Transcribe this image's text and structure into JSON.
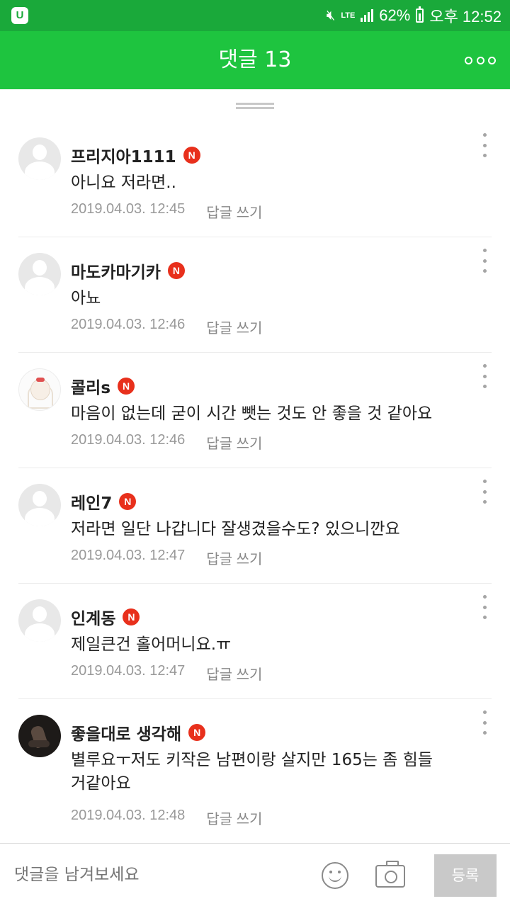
{
  "status_bar": {
    "app_badge": "U",
    "network": "LTE",
    "battery": "62%",
    "time": "오후 12:52",
    "icons": [
      "app-badge-icon",
      "mute-icon",
      "signal-icon",
      "battery-icon"
    ]
  },
  "header": {
    "title": "댓글 13",
    "more_icon": "more-horizontal-icon"
  },
  "comments": [
    {
      "author": "프리지아1111",
      "badge": "N",
      "text": "아니요 저라면..",
      "date": "2019.04.03. 12:45",
      "reply": "답글 쓰기",
      "avatar": "default-avatar-icon"
    },
    {
      "author": "마도카마기카",
      "badge": "N",
      "text": "아뇨",
      "date": "2019.04.03. 12:46",
      "reply": "답글 쓰기",
      "avatar": "default-avatar-icon"
    },
    {
      "author": "콜리s",
      "badge": "N",
      "text": "마음이 없는데 굳이 시간 뺏는 것도 안 좋을 것 같아요",
      "date": "2019.04.03. 12:46",
      "reply": "답글 쓰기",
      "avatar": "profile-illustration"
    },
    {
      "author": "레인7",
      "badge": "N",
      "text": "저라면 일단 나갑니다 잘생겼을수도? 있으니깐요",
      "date": "2019.04.03. 12:47",
      "reply": "답글 쓰기",
      "avatar": "default-avatar-icon"
    },
    {
      "author": "인계동",
      "badge": "N",
      "text": "제일큰건 홀어머니요.ㅠ",
      "date": "2019.04.03. 12:47",
      "reply": "답글 쓰기",
      "avatar": "default-avatar-icon"
    },
    {
      "author": "좋을대로 생각해",
      "badge": "N",
      "text": "별루요ㅜ저도 키작은 남편이랑 살지만 165는 좀 힘들거같아요",
      "date": "2019.04.03. 12:48",
      "reply": "답글 쓰기",
      "avatar": "profile-photo"
    }
  ],
  "input_bar": {
    "placeholder": "댓글을 남겨보세요",
    "emoji_icon": "smile-icon",
    "camera_icon": "camera-icon",
    "submit_label": "등록"
  },
  "colors": {
    "status_bar": "#1aa93a",
    "header": "#1ec43f",
    "badge": "#e8301c",
    "meta_text": "#999999"
  }
}
